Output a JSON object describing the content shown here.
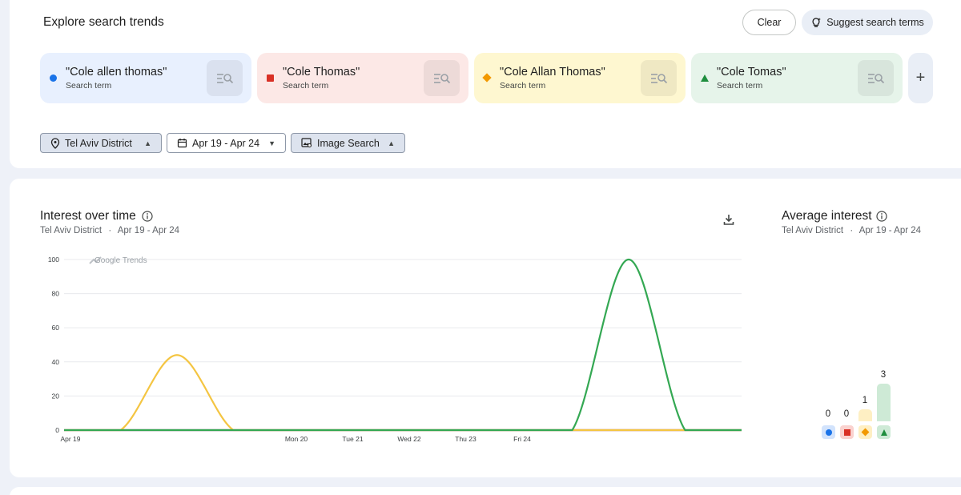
{
  "header": {
    "title": "Explore search trends",
    "clear_label": "Clear",
    "suggest_label": "Suggest search terms"
  },
  "terms": [
    {
      "label": "\"Cole allen thomas\"",
      "sub": "Search term",
      "color": "#1a73e8",
      "bg": "#e8f0fe",
      "icon": "circle"
    },
    {
      "label": "\"Cole Thomas\"",
      "sub": "Search term",
      "color": "#d93025",
      "bg": "#fce8e6",
      "icon": "square"
    },
    {
      "label": "\"Cole Allan Thomas\"",
      "sub": "Search term",
      "color": "#f29900",
      "bg": "#fef7d0",
      "icon": "diamond"
    },
    {
      "label": "\"Cole Tomas\"",
      "sub": "Search term",
      "color": "#1e8e3e",
      "bg": "#e6f4ea",
      "icon": "triangle"
    }
  ],
  "filters": {
    "location": "Tel Aviv District",
    "date": "Apr 19 - Apr 24",
    "type": "Image Search"
  },
  "interest": {
    "title": "Interest over time",
    "location": "Tel Aviv District",
    "sep": "·",
    "range": "Apr 19 - Apr 24",
    "watermark": "Google Trends"
  },
  "average": {
    "title": "Average interest",
    "location": "Tel Aviv District",
    "sep": "·",
    "range": "Apr 19 - Apr 24",
    "values": [
      "0",
      "0",
      "1",
      "3"
    ]
  },
  "chart_data": {
    "type": "line",
    "x": [
      "Apr 19",
      "Apr 19 12:00",
      "Apr 19 16:00",
      "Apr 19 20:00",
      "Mon 20",
      "Tue 21",
      "Wed 22",
      "Thu 23",
      "Fri 24",
      "Fri 24 08:00",
      "Fri 24 12:00",
      "Fri 24 16:00",
      "Fri 24 20:00"
    ],
    "xticks": [
      "Apr 19",
      "Mon 20",
      "Tue 21",
      "Wed 22",
      "Thu 23",
      "Fri 24"
    ],
    "ylim": [
      0,
      100
    ],
    "yticks": [
      "0",
      "20",
      "40",
      "60",
      "80",
      "100"
    ],
    "series": [
      {
        "name": "\"Cole allen thomas\"",
        "color": "#4285f4",
        "values": [
          0,
          0,
          0,
          0,
          0,
          0,
          0,
          0,
          0,
          0,
          0,
          0,
          0
        ]
      },
      {
        "name": "\"Cole Thomas\"",
        "color": "#ea4335",
        "values": [
          0,
          0,
          0,
          0,
          0,
          0,
          0,
          0,
          0,
          0,
          0,
          0,
          0
        ]
      },
      {
        "name": "\"Cole Allan Thomas\"",
        "color": "#f4c542",
        "values": [
          0,
          0,
          44,
          0,
          0,
          0,
          0,
          0,
          0,
          0,
          0,
          0,
          0
        ]
      },
      {
        "name": "\"Cole Tomas\"",
        "color": "#34a853",
        "values": [
          0,
          0,
          0,
          0,
          0,
          0,
          0,
          0,
          0,
          0,
          100,
          0,
          0
        ]
      }
    ],
    "grid": true
  }
}
